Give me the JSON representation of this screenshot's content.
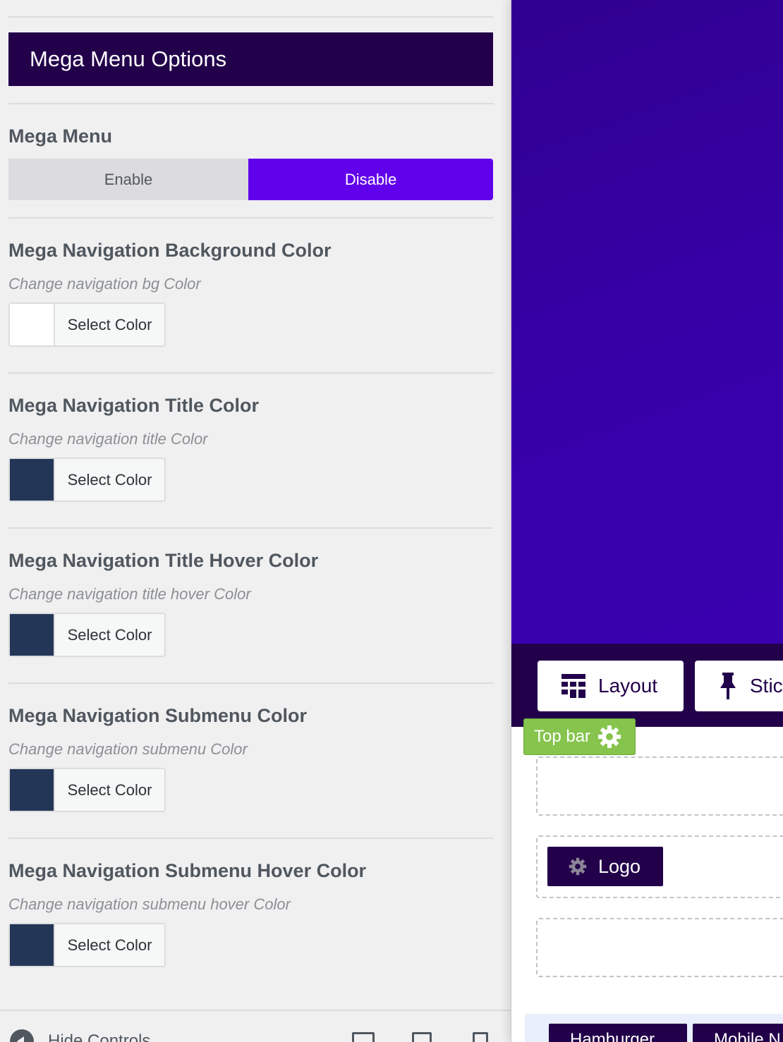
{
  "panel": {
    "section_title": "Mega Menu Options",
    "mega_menu": {
      "title": "Mega Menu",
      "options": [
        "Enable",
        "Disable"
      ],
      "selected": "Disable"
    },
    "color_fields": [
      {
        "title": "Mega Navigation Background Color",
        "description": "Change navigation bg Color",
        "button_label": "Select Color",
        "swatch": "#ffffff"
      },
      {
        "title": "Mega Navigation Title Color",
        "description": "Change navigation title Color",
        "button_label": "Select Color",
        "swatch": "#243657"
      },
      {
        "title": "Mega Navigation Title Hover Color",
        "description": "Change navigation title hover Color",
        "button_label": "Select Color",
        "swatch": "#243657"
      },
      {
        "title": "Mega Navigation Submenu Color",
        "description": "Change navigation submenu Color",
        "button_label": "Select Color",
        "swatch": "#243657"
      },
      {
        "title": "Mega Navigation Submenu Hover Color",
        "description": "Change navigation submenu hover Color",
        "button_label": "Select Color",
        "swatch": "#243657"
      }
    ],
    "footer": {
      "hide_controls": "Hide Controls"
    }
  },
  "preview": {
    "toolbar": {
      "layout": "Layout",
      "sticky": "Stic"
    },
    "top_bar_tag": "Top bar",
    "logo": "Logo",
    "bottom_items": [
      "Hamburger",
      "Mobile N"
    ]
  },
  "colors": {
    "header_bg": "#22004a",
    "accent": "#6100ea",
    "hero_bg": "#3600a8",
    "tag_green": "#86c44d"
  }
}
